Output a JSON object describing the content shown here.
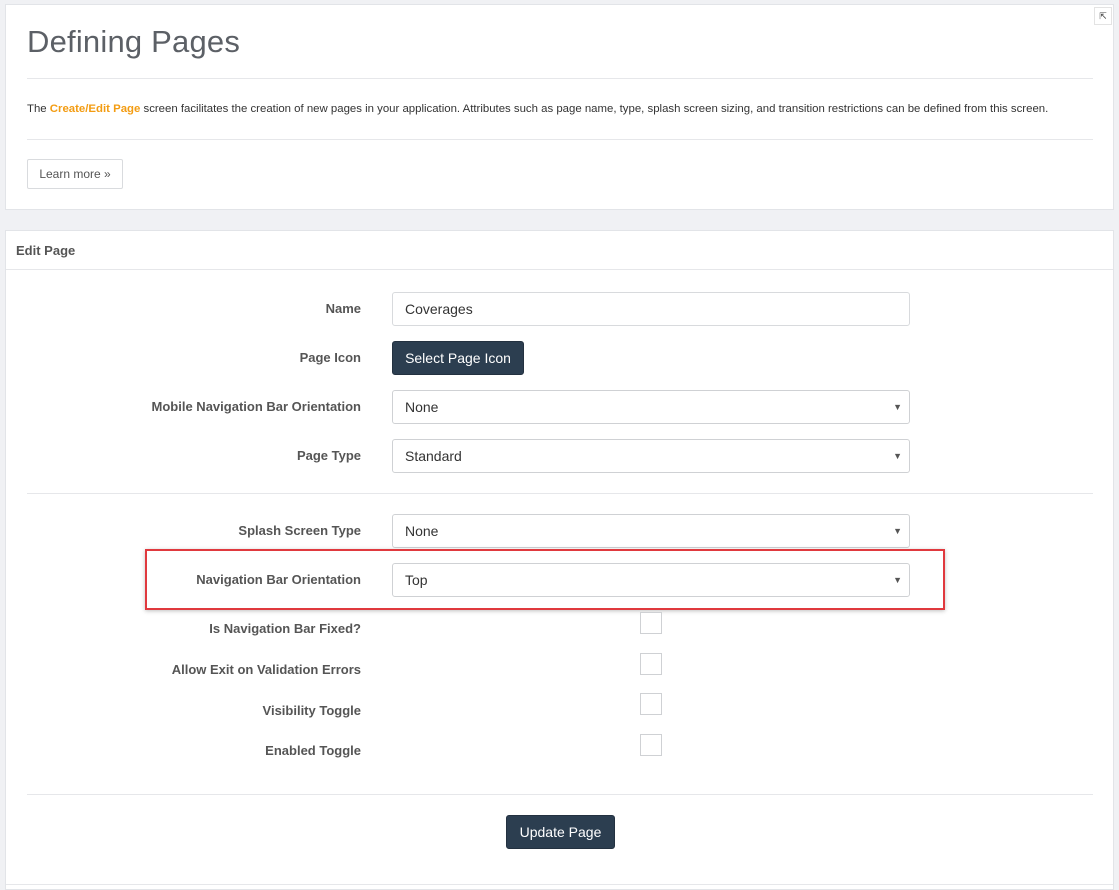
{
  "info": {
    "title": "Defining Pages",
    "description_prefix": "The ",
    "description_highlight": "Create/Edit Page",
    "description_suffix": " screen facilitates the creation of new pages in your application. Attributes such as page name, type, splash screen sizing, and transition restrictions can be defined from this screen.",
    "learn_more_label": "Learn more »",
    "collapse_glyph": "⇱"
  },
  "edit": {
    "header": "Edit Page",
    "name_label": "Name",
    "name_value": "Coverages",
    "page_icon_label": "Page Icon",
    "select_icon_label": "Select Page Icon",
    "mobile_nav_label": "Mobile Navigation Bar Orientation",
    "mobile_nav_value": "None",
    "page_type_label": "Page Type",
    "page_type_value": "Standard",
    "splash_label": "Splash Screen Type",
    "splash_value": "None",
    "nav_orientation_label": "Navigation Bar Orientation",
    "nav_orientation_value": "Top",
    "nav_fixed_label": "Is Navigation Bar Fixed?",
    "allow_exit_label": "Allow Exit on Validation Errors",
    "visibility_label": "Visibility Toggle",
    "enabled_label": "Enabled Toggle",
    "update_label": "Update Page",
    "caret_glyph": "▼"
  },
  "colors": {
    "accent": "#f39c12",
    "button_dark": "#2c3e50",
    "highlight": "#e0393e"
  }
}
